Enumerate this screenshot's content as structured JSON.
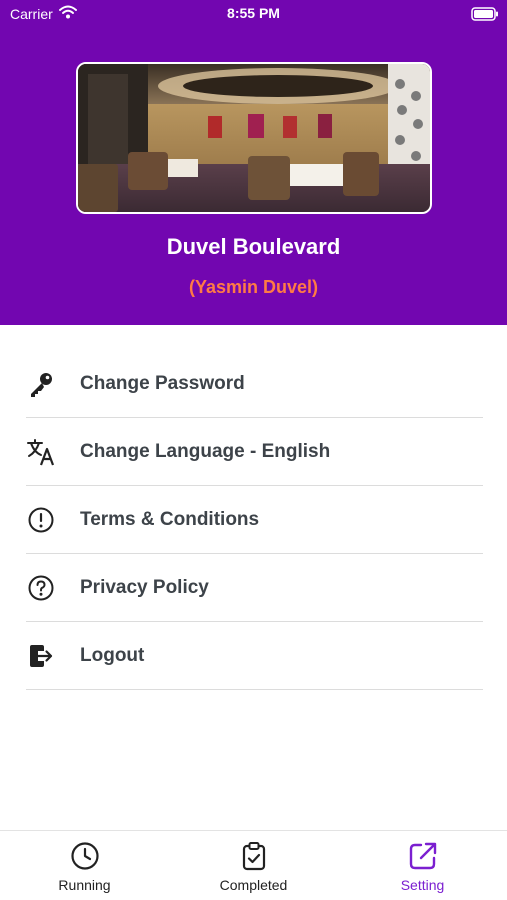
{
  "status_bar": {
    "carrier": "Carrier",
    "time": "8:55 PM"
  },
  "profile": {
    "venue_name": "Duvel Boulevard",
    "owner_name": "(Yasmin Duvel)"
  },
  "menu": [
    {
      "label": "Change Password",
      "icon": "key-icon"
    },
    {
      "label": "Change Language - English",
      "icon": "translate-icon"
    },
    {
      "label": "Terms & Conditions",
      "icon": "exclamation-circle-icon"
    },
    {
      "label": "Privacy Policy",
      "icon": "question-circle-icon"
    },
    {
      "label": "Logout",
      "icon": "logout-icon"
    }
  ],
  "tabs": [
    {
      "label": "Running",
      "icon": "clock-icon",
      "active": false
    },
    {
      "label": "Completed",
      "icon": "clipboard-check-icon",
      "active": false
    },
    {
      "label": "Setting",
      "icon": "external-share-icon",
      "active": true
    }
  ],
  "colors": {
    "header_bg": "#7206b0",
    "owner_name": "#ff7a45",
    "active_tab": "#7b1fd0",
    "menu_text": "#3d4349"
  }
}
